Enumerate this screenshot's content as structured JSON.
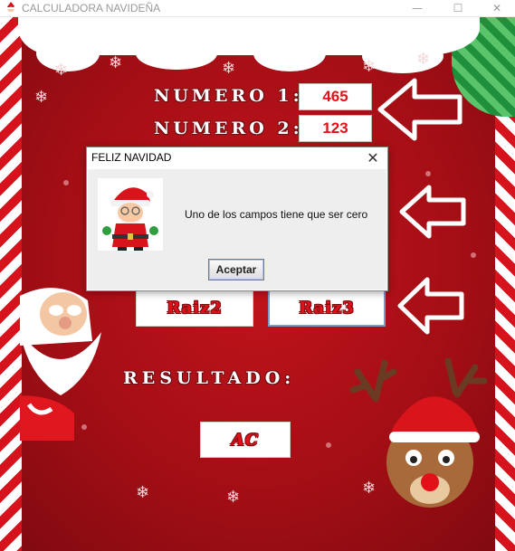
{
  "window": {
    "title": "CALCULADORA NAVIDEÑA",
    "minimize_glyph": "—",
    "maximize_glyph": "☐",
    "close_glyph": "✕"
  },
  "form": {
    "numero1_label": "NUMERO 1:",
    "numero1_value": "465",
    "numero2_label": "NUMERO 2:",
    "numero2_value": "123",
    "resultado_label": "RESULTADO:"
  },
  "buttons": {
    "raiz2": "Raiz2",
    "raiz3": "Raiz3",
    "ac": "AC"
  },
  "dialog": {
    "title": "FELIZ NAVIDAD",
    "close_glyph": "✕",
    "message": "Uno de los campos tiene que ser cero",
    "ok_label": "Aceptar"
  },
  "colors": {
    "background_red": "#b01019",
    "value_red": "#e3101a",
    "stripe_white": "#ffffff",
    "ribbon_green": "#1f8f3c",
    "arrow_white": "#ffffff"
  },
  "icons": {
    "app": "santa-icon",
    "dialog": "santa-icon",
    "arrows": "left-arrow-icon"
  }
}
